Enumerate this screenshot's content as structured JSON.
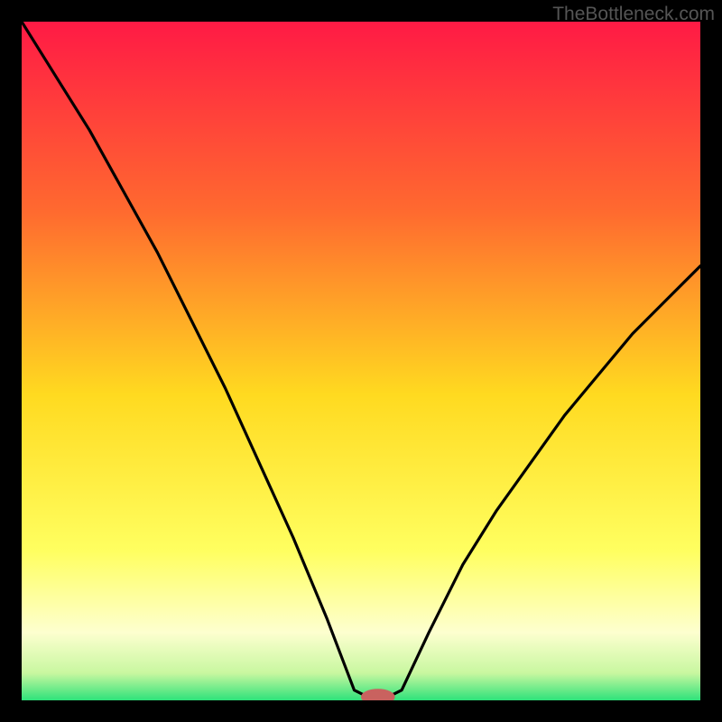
{
  "watermark": "TheBottleneck.com",
  "colors": {
    "bg": "#000000",
    "top": "#ff1a45",
    "mid_upper": "#ff7b2a",
    "mid": "#ffda20",
    "mid_lower": "#ffff90",
    "band_pale": "#fdffcf",
    "bottom": "#2ee27a",
    "curve": "#000000",
    "marker": "#c9625f"
  },
  "chart_data": {
    "type": "line",
    "title": "",
    "xlabel": "",
    "ylabel": "",
    "xlim": [
      0,
      100
    ],
    "ylim": [
      0,
      100
    ],
    "curve_points": [
      {
        "x": 0,
        "y": 100
      },
      {
        "x": 5,
        "y": 92
      },
      {
        "x": 10,
        "y": 84
      },
      {
        "x": 15,
        "y": 75
      },
      {
        "x": 20,
        "y": 66
      },
      {
        "x": 25,
        "y": 56
      },
      {
        "x": 30,
        "y": 46
      },
      {
        "x": 35,
        "y": 35
      },
      {
        "x": 40,
        "y": 24
      },
      {
        "x": 45,
        "y": 12
      },
      {
        "x": 49,
        "y": 1.5
      },
      {
        "x": 51,
        "y": 0.5
      },
      {
        "x": 54,
        "y": 0.5
      },
      {
        "x": 56,
        "y": 1.5
      },
      {
        "x": 60,
        "y": 10
      },
      {
        "x": 65,
        "y": 20
      },
      {
        "x": 70,
        "y": 28
      },
      {
        "x": 75,
        "y": 35
      },
      {
        "x": 80,
        "y": 42
      },
      {
        "x": 85,
        "y": 48
      },
      {
        "x": 90,
        "y": 54
      },
      {
        "x": 95,
        "y": 59
      },
      {
        "x": 100,
        "y": 64
      }
    ],
    "marker": {
      "x": 52.5,
      "y": 0.5,
      "rx": 2.5,
      "ry": 1.2
    }
  }
}
